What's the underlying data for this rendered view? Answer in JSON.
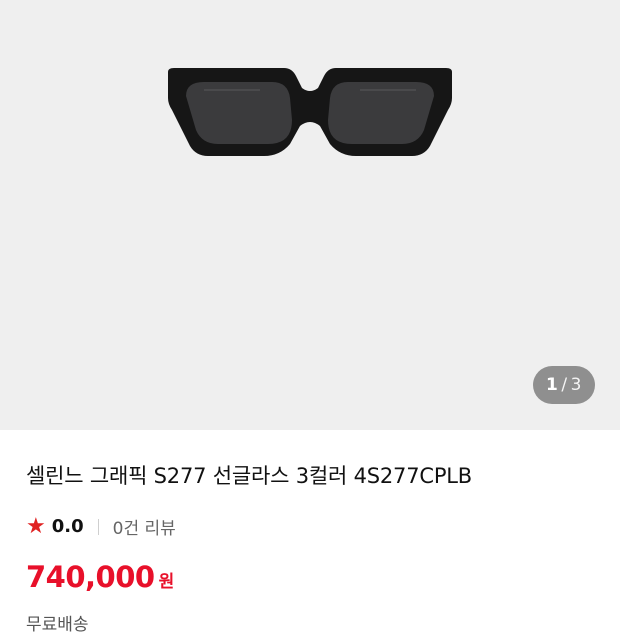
{
  "gallery": {
    "pager": {
      "current": "1",
      "separator": "/",
      "total": "3"
    }
  },
  "product": {
    "title": "셀린느 그래픽 S277 선글라스 3컬러 4S277CPLB",
    "rating": {
      "score": "0.0",
      "reviews": "0건 리뷰"
    },
    "price": {
      "amount": "740,000",
      "unit": "원"
    },
    "shipping": "무료배송"
  },
  "colors": {
    "accent": "#e8102a",
    "star": "#e02222",
    "gallery_bg": "#efefef",
    "pager_bg": "#8f8f8f"
  }
}
